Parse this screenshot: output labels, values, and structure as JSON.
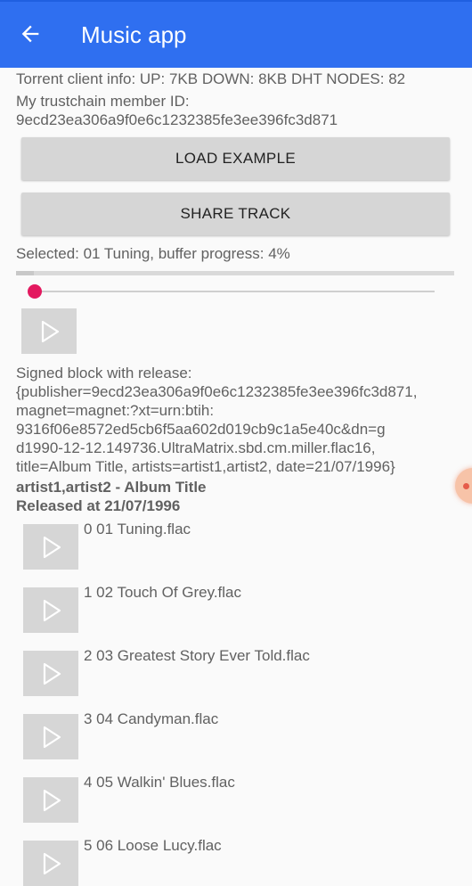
{
  "app": {
    "title": "Music app"
  },
  "info": {
    "torrent": "Torrent client info: UP: 7KB DOWN: 8KB DHT NODES: 82",
    "member_label": "My trustchain member ID:",
    "member_id": "9ecd23ea306a9f0e6c1232385fe3ee396fc3d871"
  },
  "buttons": {
    "load_example": "LOAD EXAMPLE",
    "share_track": "SHARE TRACK"
  },
  "status": {
    "selected": "Selected: 01 Tuning, buffer progress: 4%",
    "buffer_progress": 0.04,
    "playback_position": 0.0
  },
  "block": {
    "lines": [
      "Signed block with release:",
      "{publisher=9ecd23ea306a9f0e6c1232385fe3ee396fc3d871,",
      "magnet=magnet:?xt=urn:btih:",
      "9316f06e8572ed5cb6f5aa602d019cb9c1a5e40c&dn=g",
      "d1990-12-12.149736.UltraMatrix.sbd.cm.miller.flac16,",
      "title=Album Title, artists=artist1,artist2, date=21/07/1996}"
    ]
  },
  "album": {
    "heading": "artist1,artist2 - Album Title",
    "released": "Released at 21/07/1996"
  },
  "tracks": [
    {
      "label": "0  01 Tuning.flac"
    },
    {
      "label": "1  02 Touch Of Grey.flac"
    },
    {
      "label": "2  03 Greatest Story Ever Told.flac"
    },
    {
      "label": "3  04 Candyman.flac"
    },
    {
      "label": "4  05 Walkin' Blues.flac"
    },
    {
      "label": "5  06 Loose Lucy.flac"
    }
  ],
  "icons": {
    "back": "arrow-back-icon",
    "play": "play-icon",
    "floating": "floating-bubble-icon"
  },
  "colors": {
    "appbar": "#2f6ff0",
    "seek_thumb": "#e3195f",
    "button_bg": "#d6d6d6"
  }
}
